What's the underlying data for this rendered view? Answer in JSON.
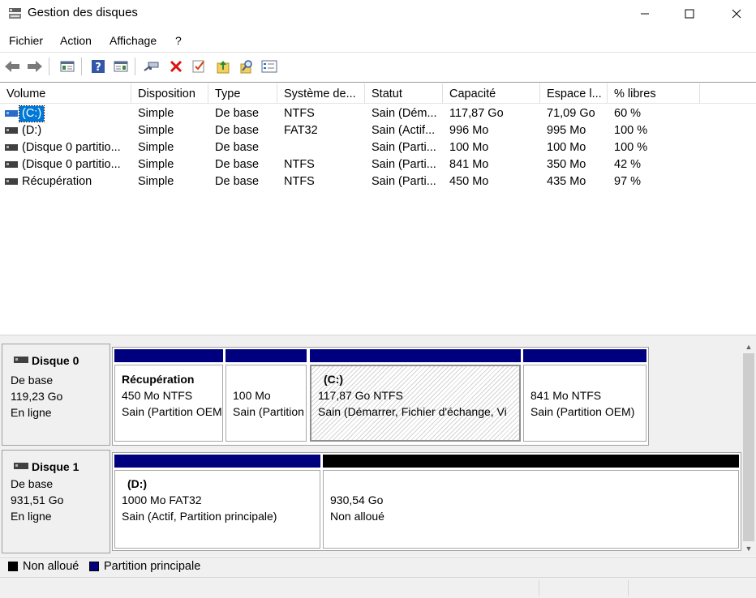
{
  "window": {
    "title": "Gestion des disques"
  },
  "menu": [
    "Fichier",
    "Action",
    "Affichage",
    "?"
  ],
  "toolbar_icons": [
    "back-icon",
    "forward-icon",
    "console-tree-icon",
    "help-icon",
    "properties-pane-icon",
    "connect-icon",
    "delete-icon",
    "checkmark-icon",
    "import-icon",
    "search-icon",
    "list-view-icon"
  ],
  "columns": [
    "Volume",
    "Disposition",
    "Type",
    "Système de...",
    "Statut",
    "Capacité",
    "Espace l...",
    "% libres"
  ],
  "volumes": [
    {
      "name": "(C:)",
      "layout": "Simple",
      "type": "De base",
      "fs": "NTFS",
      "status": "Sain (Dém...",
      "capacity": "117,87 Go",
      "free": "71,09 Go",
      "pct": "60 %"
    },
    {
      "name": "(D:)",
      "layout": "Simple",
      "type": "De base",
      "fs": "FAT32",
      "status": "Sain (Actif...",
      "capacity": "996 Mo",
      "free": "995 Mo",
      "pct": "100 %"
    },
    {
      "name": "(Disque 0 partitio...",
      "layout": "Simple",
      "type": "De base",
      "fs": "",
      "status": "Sain (Parti...",
      "capacity": "100 Mo",
      "free": "100 Mo",
      "pct": "100 %"
    },
    {
      "name": "(Disque 0 partitio...",
      "layout": "Simple",
      "type": "De base",
      "fs": "NTFS",
      "status": "Sain (Parti...",
      "capacity": "841 Mo",
      "free": "350 Mo",
      "pct": "42 %"
    },
    {
      "name": "Récupération",
      "layout": "Simple",
      "type": "De base",
      "fs": "NTFS",
      "status": "Sain (Parti...",
      "capacity": "450 Mo",
      "free": "435 Mo",
      "pct": "97 %"
    }
  ],
  "disks": [
    {
      "name": "Disque 0",
      "kind": "De base",
      "size": "119,23 Go",
      "state": "En ligne",
      "partitions": [
        {
          "title": "Récupération",
          "line1": "450 Mo NTFS",
          "line2": "Sain (Partition OEM)"
        },
        {
          "title": "",
          "line1": "100 Mo",
          "line2": "Sain (Partition"
        },
        {
          "title": "(C:)",
          "line1": "117,87 Go NTFS",
          "line2": "Sain (Démarrer, Fichier d'échange, Vi"
        },
        {
          "title": "",
          "line1": "841 Mo NTFS",
          "line2": "Sain (Partition OEM)"
        }
      ]
    },
    {
      "name": "Disque 1",
      "kind": "De base",
      "size": "931,51 Go",
      "state": "En ligne",
      "partitions": [
        {
          "title": "(D:)",
          "line1": "1000 Mo FAT32",
          "line2": "Sain (Actif, Partition principale)"
        },
        {
          "title": "",
          "line1": "930,54 Go",
          "line2": "Non alloué"
        }
      ]
    }
  ],
  "legend": [
    {
      "label": "Non alloué",
      "color": "#000000"
    },
    {
      "label": "Partition principale",
      "color": "#00007f"
    }
  ],
  "colors": {
    "primary_partition": "#00007f",
    "unallocated": "#000000",
    "selection": "#0078d7"
  }
}
